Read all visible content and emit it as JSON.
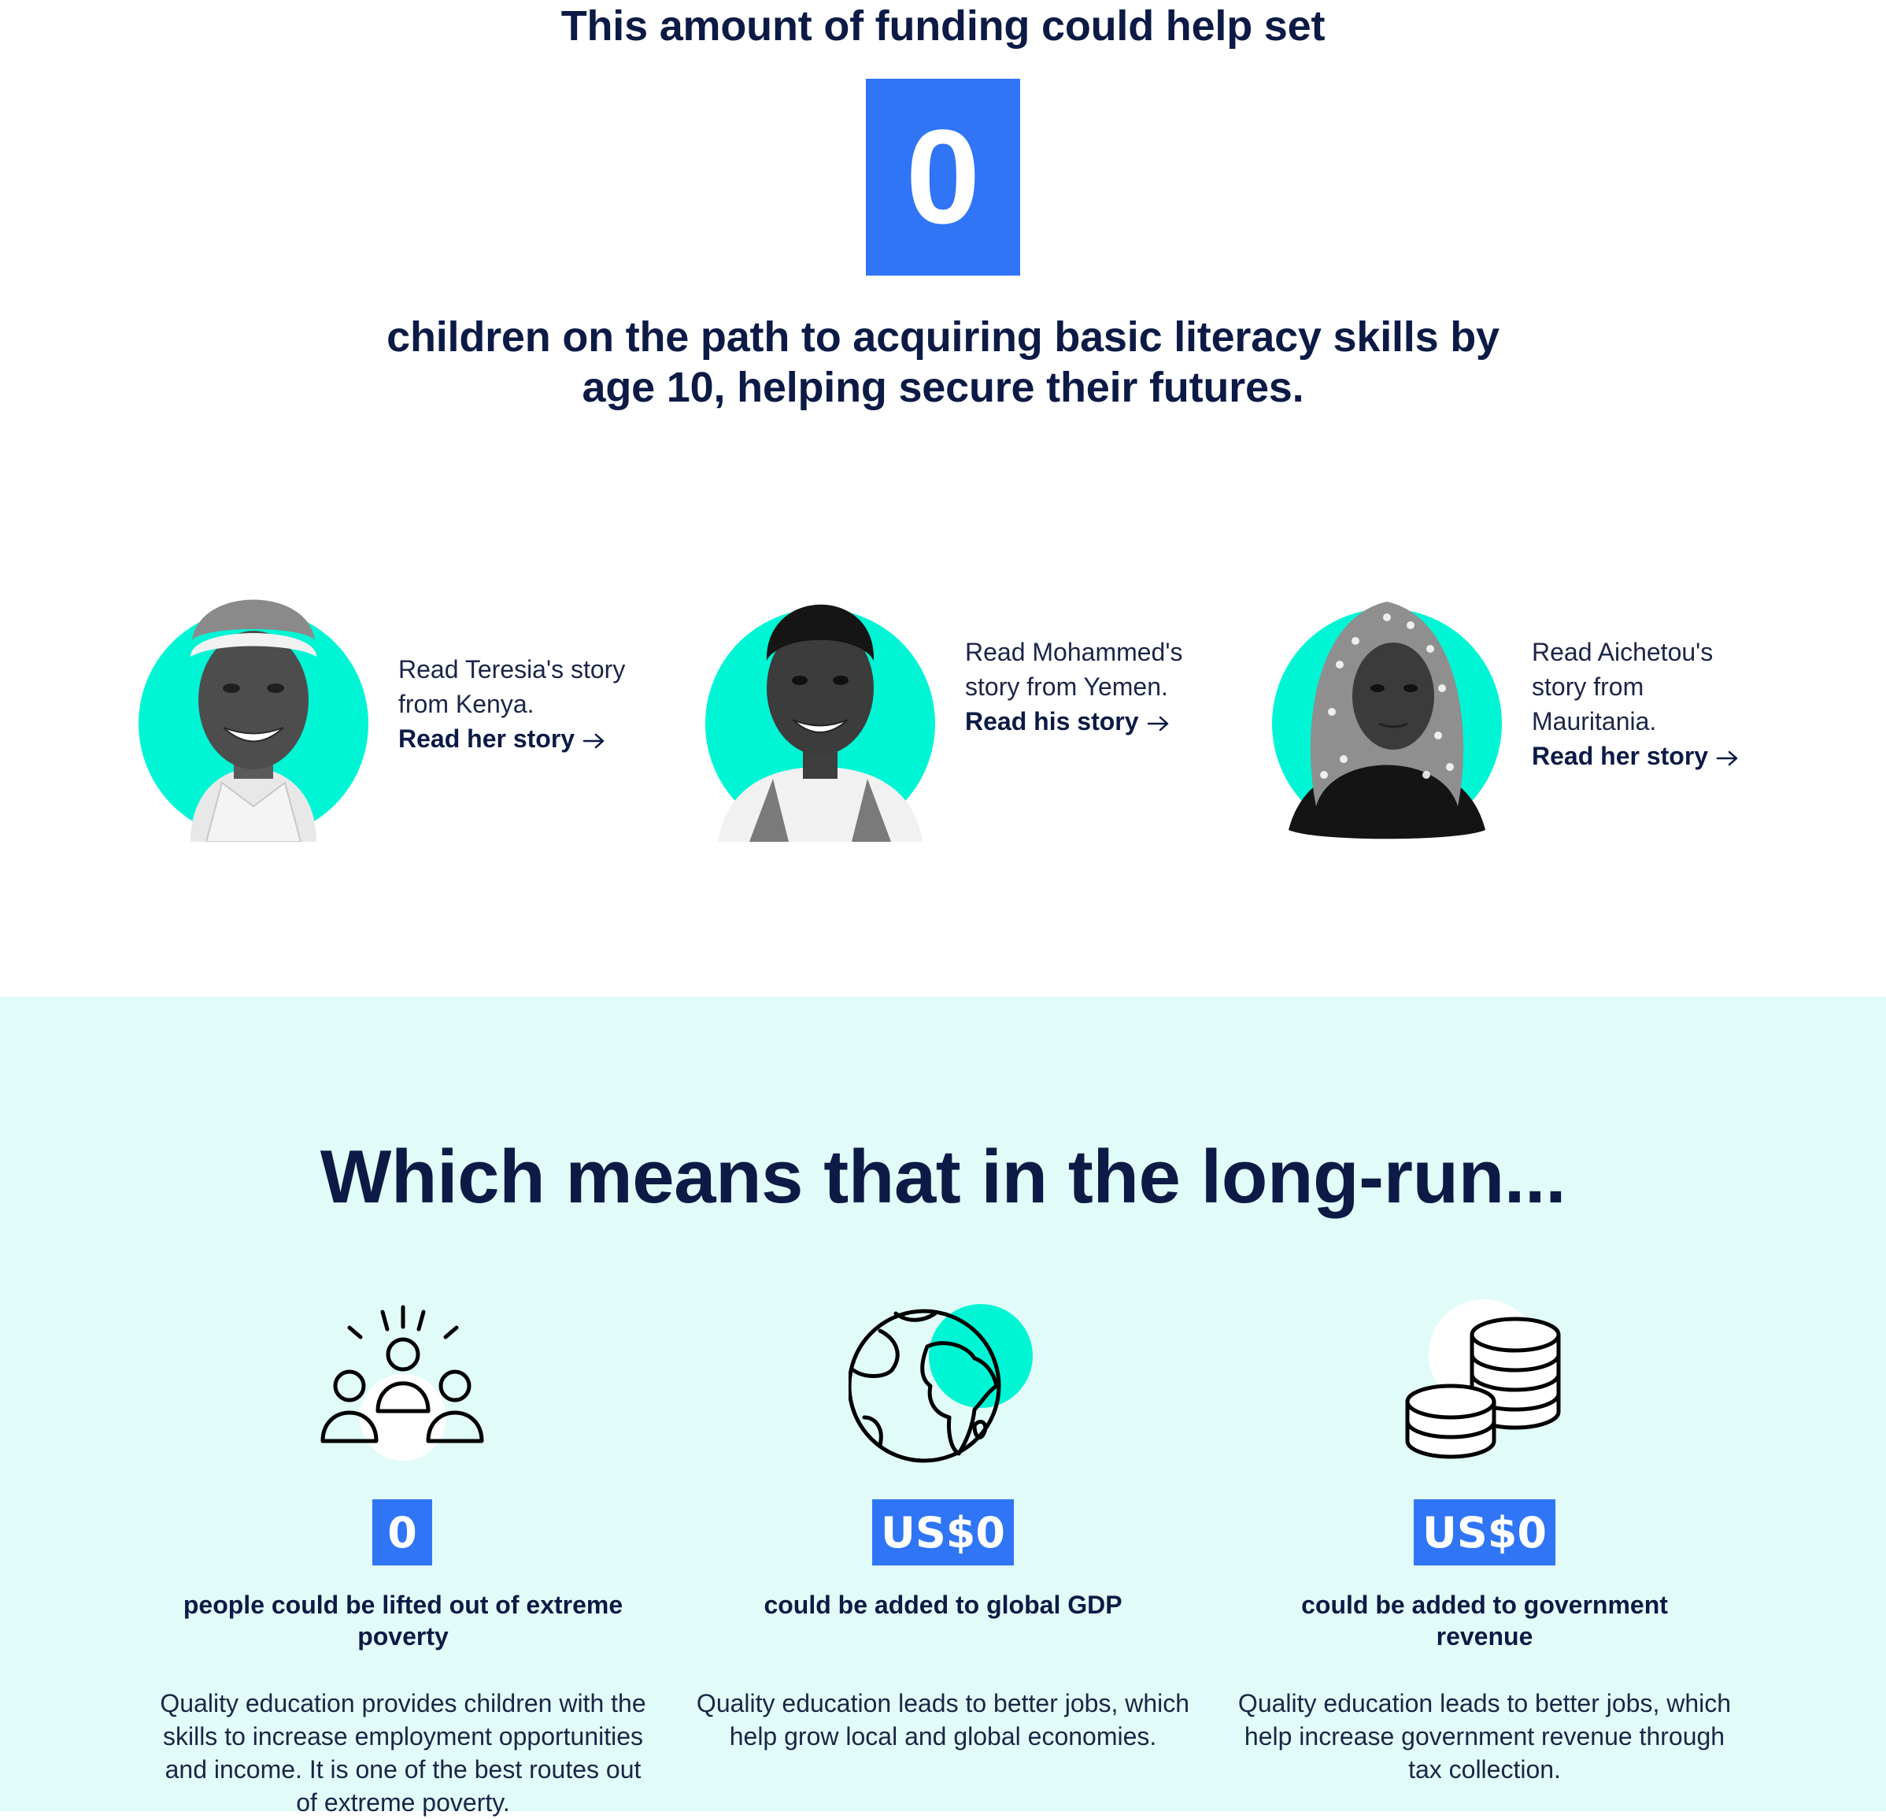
{
  "hero": {
    "intro": "This amount of funding could help set",
    "counter": "0",
    "outcome": "children on the path to acquiring basic literacy skills by age 10, helping secure their futures."
  },
  "stories": [
    {
      "text": "Read Teresia's story from Kenya.",
      "link": "Read her story"
    },
    {
      "text": "Read Mohammed's story from Yemen.",
      "link": "Read his story"
    },
    {
      "text": "Read Aichetou's story from Mauritania.",
      "link": "Read her story"
    }
  ],
  "longrun": {
    "heading": "Which means that in the long-run...",
    "items": [
      {
        "icon": "people-icon",
        "value": "0",
        "title": "people could be lifted out of extreme poverty",
        "description": "Quality education provides children with the skills to increase employment opportunities and income. It is one of the best routes out of extreme poverty."
      },
      {
        "icon": "globe-icon",
        "value": "US$0",
        "title": "could be added to global GDP",
        "description": "Quality education leads to better jobs, which help grow local and global economies."
      },
      {
        "icon": "coins-icon",
        "value": "US$0",
        "title": "could be added to government revenue",
        "description": "Quality education leads to better jobs, which help increase government revenue through tax collection."
      }
    ]
  },
  "colors": {
    "navy": "#0c1a45",
    "blue": "#2f75f5",
    "teal": "#00f5d4",
    "mint_bg": "#e1fcf8"
  }
}
